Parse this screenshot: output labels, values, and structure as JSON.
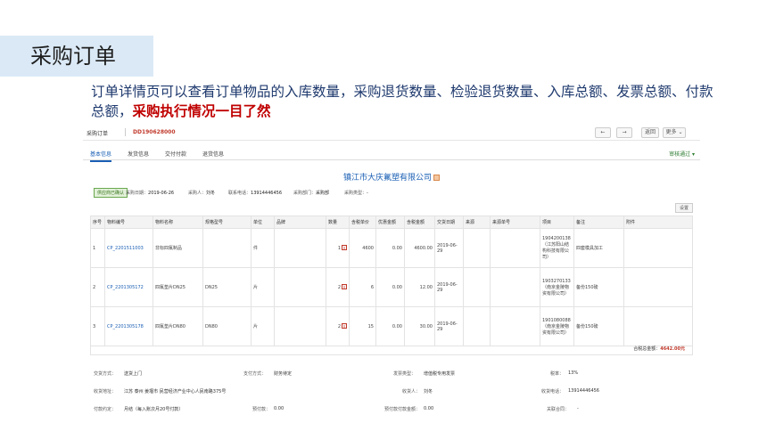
{
  "slide": {
    "title": "采购订单",
    "desc_normal": "订单详情页可以查看订单物品的入库数量，采购退货数量、检验退货数量、入库总额、发票总额、付款总额，",
    "desc_highlight": "采购执行情况一目了然"
  },
  "topbar": {
    "breadcrumb": "采购订单",
    "order_no": "DD190628000",
    "prev_icon": "←",
    "next_icon": "→",
    "back_label": "返回",
    "more_label": "更多 ⌄"
  },
  "tabs": [
    {
      "label": "基本信息",
      "active": true
    },
    {
      "label": "发货信息"
    },
    {
      "label": "交付付款"
    },
    {
      "label": "退货信息"
    }
  ],
  "audit_status": "审核通过 ▾",
  "company": "镇江市大庆氟塑有限公司",
  "info": {
    "status_tag": "供应商已确认",
    "purchase_date_label": "采购日期：",
    "purchase_date": "2019-06-26",
    "buyer_label": "采购人：",
    "buyer": "刘冬",
    "phone_label": "联系电话：",
    "phone": "13914446456",
    "dept_label": "采购部门：",
    "dept": "采购部",
    "type_label": "采购类型：",
    "type": "-"
  },
  "settings_label": "设置",
  "table": {
    "headers": [
      "序号",
      "物料编号",
      "物料名称",
      "规格型号",
      "单位",
      "品牌",
      "数量",
      "含税单价",
      "优惠金额",
      "含税金额",
      "交货日期",
      "来源",
      "来源单号",
      "项目",
      "备注",
      "附件"
    ],
    "rows": [
      {
        "no": "1",
        "code": "CP_2201511003",
        "name": "非标四氟制品",
        "spec": "",
        "unit": "件",
        "brand": "",
        "qty": "1",
        "price": "4600",
        "discount": "0.00",
        "amount": "4600.00",
        "date": "2019-06-29",
        "source": "",
        "source_no": "",
        "project": "1904200138（江苏阳山结构科技有限公司）",
        "remark": "四套模具加工",
        "attach": ""
      },
      {
        "no": "2",
        "code": "CP_2201305172",
        "name": "四氟垫片DN25",
        "spec": "DN25",
        "unit": "片",
        "brand": "",
        "qty": "2",
        "price": "6",
        "discount": "0.00",
        "amount": "12.00",
        "date": "2019-06-29",
        "source": "",
        "source_no": "",
        "project": "1903270133（南京金陵物资有限公司）",
        "remark": "备份150磅",
        "attach": ""
      },
      {
        "no": "3",
        "code": "CP_2201305178",
        "name": "四氟垫片DN80",
        "spec": "DN80",
        "unit": "片",
        "brand": "",
        "qty": "2",
        "price": "15",
        "discount": "0.00",
        "amount": "30.00",
        "date": "2019-06-29",
        "source": "",
        "source_no": "",
        "project": "1901080088（南京金陵物资有限公司）",
        "remark": "备份150磅",
        "attach": ""
      }
    ],
    "v_mark": "V"
  },
  "total": {
    "label": "合税总金额：",
    "value": "4642.00元"
  },
  "footer": {
    "row1": {
      "trade_label": "交货方式：",
      "trade": "送货上门",
      "pay_label": "支付方式：",
      "pay": "财务待定",
      "invoice_type_label": "发票类型：",
      "invoice_type": "增值税专用发票",
      "tax_label": "税率：",
      "tax": "13%"
    },
    "row2": {
      "addr_label": "收货地址：",
      "addr": "江苏 泰州 姜堰市 民营经济产业中心人民南路375号",
      "receiver_label": "收货人：",
      "receiver": "刘冬",
      "rphone_label": "收货电话：",
      "rphone": "13914446456"
    },
    "row3": {
      "term_label": "付款约定：",
      "term": "月结（每入账次月20号付款）",
      "prepay_label": "预付款：",
      "prepay": "0.00",
      "prepay_ratio_label": "预付款付款金额：",
      "prepay_ratio": "0.00",
      "contract_label": "关联合同：",
      "contract": "-"
    }
  },
  "colors": {
    "accent": "#1a5fb4",
    "highlight": "#c00000",
    "title_bg": "#dbe9f6"
  }
}
